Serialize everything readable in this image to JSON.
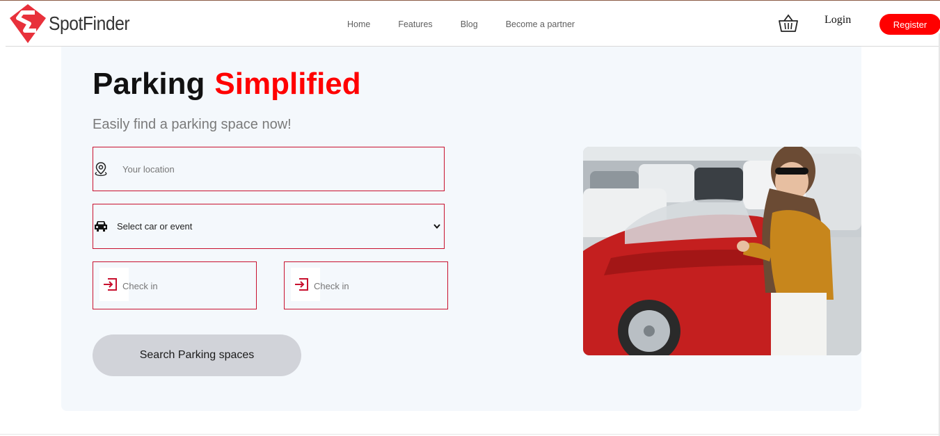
{
  "header": {
    "logo_text": "SpotFinder",
    "nav": [
      {
        "label": "Home"
      },
      {
        "label": "Features"
      },
      {
        "label": "Blog"
      },
      {
        "label": "Become a partner"
      }
    ],
    "login_label": "Login",
    "register_label": "Register"
  },
  "hero": {
    "title_part1": "Parking",
    "title_part2": "Simplified",
    "subtitle": "Easily find a parking space now!",
    "location_placeholder": "Your location",
    "select_value": "Select car or event",
    "checkin1_label": "Check in",
    "checkin2_label": "Check in",
    "search_button_label": "Search Parking spaces"
  },
  "colors": {
    "accent": "#ff0000",
    "field_border": "#c8102e",
    "hero_bg": "#f4f8fc",
    "button_bg": "#d1d3d9"
  },
  "icons": {
    "logo": "spotfinder-logo-icon",
    "cart": "basket-icon",
    "location": "map-pin-icon",
    "car": "car-icon",
    "checkin": "sign-in-icon",
    "dropdown": "chevron-down-icon"
  }
}
